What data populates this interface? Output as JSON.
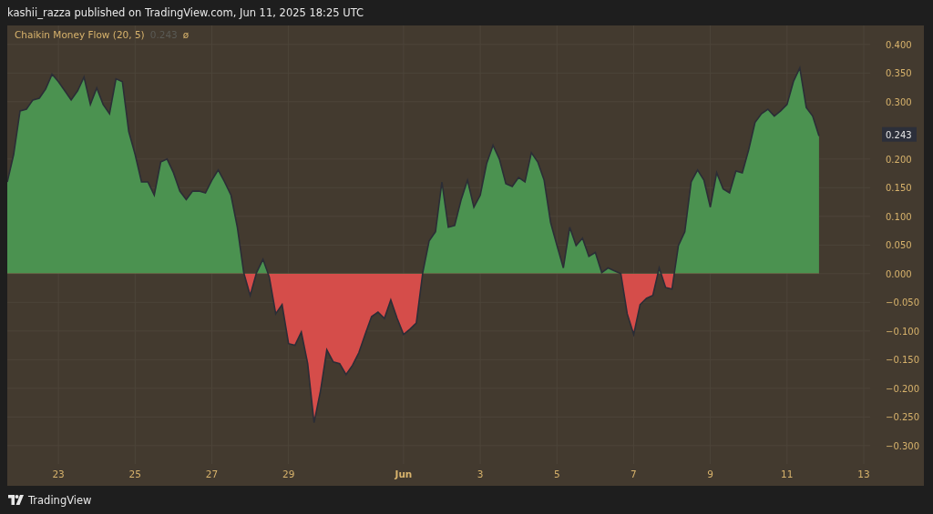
{
  "header": {
    "text": "kashii_razza published on TradingView.com, Jun 11, 2025 18:25 UTC"
  },
  "legend": {
    "value": "0.243",
    "symbol": "ø"
  },
  "chart": {
    "price_tag": "0.243",
    "chart_data": {
      "type": "area",
      "grid": true,
      "xlim": [
        "2025-05-21 16:00",
        "2025-06-13 04:00"
      ],
      "ylim": [
        -0.332,
        0.433
      ],
      "xticks": [
        {
          "value": "2025-05-23",
          "label": "23"
        },
        {
          "value": "2025-05-25",
          "label": "25"
        },
        {
          "value": "2025-05-27",
          "label": "27"
        },
        {
          "value": "2025-05-29",
          "label": "29"
        },
        {
          "value": "2025-06-01",
          "label": "Jun"
        },
        {
          "value": "2025-06-03",
          "label": "3"
        },
        {
          "value": "2025-06-05",
          "label": "5"
        },
        {
          "value": "2025-06-07",
          "label": "7"
        },
        {
          "value": "2025-06-09",
          "label": "9"
        },
        {
          "value": "2025-06-11",
          "label": "11"
        },
        {
          "value": "2025-06-13",
          "label": "13"
        }
      ],
      "yticks": [
        {
          "value": 0.4,
          "label": "0.400"
        },
        {
          "value": 0.35,
          "label": "0.350"
        },
        {
          "value": 0.3,
          "label": "0.300"
        },
        {
          "value": 0.2,
          "label": "0.200"
        },
        {
          "value": 0.15,
          "label": "0.150"
        },
        {
          "value": 0.1,
          "label": "0.100"
        },
        {
          "value": 0.05,
          "label": "0.050"
        },
        {
          "value": 0,
          "label": "0.000"
        },
        {
          "value": -0.05,
          "label": "−0.050"
        },
        {
          "value": -0.1,
          "label": "−0.100"
        },
        {
          "value": -0.15,
          "label": "−0.150"
        },
        {
          "value": -0.2,
          "label": "−0.200"
        },
        {
          "value": -0.25,
          "label": "−0.250"
        },
        {
          "value": -0.3,
          "label": "−0.300"
        }
      ],
      "x": [
        "2025-05-21 16:00",
        "2025-05-21 20:00",
        "2025-05-22 00:00",
        "2025-05-22 04:00",
        "2025-05-22 08:00",
        "2025-05-22 12:00",
        "2025-05-22 16:00",
        "2025-05-22 20:00",
        "2025-05-23 00:00",
        "2025-05-23 04:00",
        "2025-05-23 08:00",
        "2025-05-23 12:00",
        "2025-05-23 16:00",
        "2025-05-23 20:00",
        "2025-05-24 00:00",
        "2025-05-24 04:00",
        "2025-05-24 08:00",
        "2025-05-24 12:00",
        "2025-05-24 16:00",
        "2025-05-24 20:00",
        "2025-05-25 00:00",
        "2025-05-25 04:00",
        "2025-05-25 08:00",
        "2025-05-25 12:00",
        "2025-05-25 16:00",
        "2025-05-25 20:00",
        "2025-05-26 00:00",
        "2025-05-26 04:00",
        "2025-05-26 08:00",
        "2025-05-26 12:00",
        "2025-05-26 16:00",
        "2025-05-26 20:00",
        "2025-05-27 00:00",
        "2025-05-27 04:00",
        "2025-05-27 08:00",
        "2025-05-27 12:00",
        "2025-05-27 16:00",
        "2025-05-27 20:00",
        "2025-05-28 00:00",
        "2025-05-28 04:00",
        "2025-05-28 08:00",
        "2025-05-28 12:00",
        "2025-05-28 16:00",
        "2025-05-28 20:00",
        "2025-05-29 00:00",
        "2025-05-29 04:00",
        "2025-05-29 08:00",
        "2025-05-29 12:00",
        "2025-05-29 16:00",
        "2025-05-29 20:00",
        "2025-05-30 00:00",
        "2025-05-30 04:00",
        "2025-05-30 08:00",
        "2025-05-30 12:00",
        "2025-05-30 16:00",
        "2025-05-30 20:00",
        "2025-05-31 00:00",
        "2025-05-31 04:00",
        "2025-05-31 08:00",
        "2025-05-31 12:00",
        "2025-05-31 16:00",
        "2025-05-31 20:00",
        "2025-06-01 00:00",
        "2025-06-01 04:00",
        "2025-06-01 08:00",
        "2025-06-01 12:00",
        "2025-06-01 16:00",
        "2025-06-01 20:00",
        "2025-06-02 00:00",
        "2025-06-02 04:00",
        "2025-06-02 08:00",
        "2025-06-02 12:00",
        "2025-06-02 16:00",
        "2025-06-02 20:00",
        "2025-06-03 00:00",
        "2025-06-03 04:00",
        "2025-06-03 08:00",
        "2025-06-03 12:00",
        "2025-06-03 16:00",
        "2025-06-03 20:00",
        "2025-06-04 00:00",
        "2025-06-04 04:00",
        "2025-06-04 08:00",
        "2025-06-04 12:00",
        "2025-06-04 16:00",
        "2025-06-04 20:00",
        "2025-06-05 00:00",
        "2025-06-05 04:00",
        "2025-06-05 08:00",
        "2025-06-05 12:00",
        "2025-06-05 16:00",
        "2025-06-05 20:00",
        "2025-06-06 00:00",
        "2025-06-06 04:00",
        "2025-06-06 08:00",
        "2025-06-06 12:00",
        "2025-06-06 16:00",
        "2025-06-06 20:00",
        "2025-06-07 00:00",
        "2025-06-07 04:00",
        "2025-06-07 08:00",
        "2025-06-07 12:00",
        "2025-06-07 16:00",
        "2025-06-07 20:00",
        "2025-06-08 00:00",
        "2025-06-08 04:00",
        "2025-06-08 08:00",
        "2025-06-08 12:00",
        "2025-06-08 16:00",
        "2025-06-08 20:00",
        "2025-06-09 00:00",
        "2025-06-09 04:00",
        "2025-06-09 08:00",
        "2025-06-09 12:00",
        "2025-06-09 16:00",
        "2025-06-09 20:00",
        "2025-06-10 00:00",
        "2025-06-10 04:00",
        "2025-06-10 08:00",
        "2025-06-10 12:00",
        "2025-06-10 16:00",
        "2025-06-10 20:00",
        "2025-06-11 00:00",
        "2025-06-11 04:00",
        "2025-06-11 08:00",
        "2025-06-11 12:00",
        "2025-06-11 16:00",
        "2025-06-11 20:00"
      ],
      "series": [
        {
          "name": "Chaikin Money Flow (20, 5)",
          "color": "#4b9250",
          "values": [
            0.16,
            0.208,
            0.284,
            0.287,
            0.303,
            0.306,
            0.322,
            0.348,
            0.335,
            0.319,
            0.303,
            0.319,
            0.343,
            0.295,
            0.324,
            0.295,
            0.279,
            0.34,
            0.335,
            0.248,
            0.208,
            0.16,
            0.16,
            0.137,
            0.195,
            0.2,
            0.176,
            0.144,
            0.129,
            0.144,
            0.144,
            0.141,
            0.163,
            0.181,
            0.16,
            0.137,
            0.081,
            0.002,
            -0.038,
            0.002,
            0.025,
            -0.006,
            -0.07,
            -0.054,
            -0.122,
            -0.125,
            -0.102,
            -0.157,
            -0.26,
            -0.205,
            -0.133,
            -0.154,
            -0.157,
            -0.176,
            -0.16,
            -0.138,
            -0.106,
            -0.075,
            -0.067,
            -0.078,
            -0.046,
            -0.078,
            -0.106,
            -0.097,
            -0.086,
            0.002,
            0.057,
            0.073,
            0.16,
            0.081,
            0.084,
            0.129,
            0.163,
            0.116,
            0.137,
            0.192,
            0.224,
            0.2,
            0.157,
            0.152,
            0.168,
            0.16,
            0.211,
            0.195,
            0.163,
            0.089,
            0.049,
            0.01,
            0.081,
            0.049,
            0.062,
            0.03,
            0.037,
            0.002,
            0.01,
            0.005,
            0,
            -0.07,
            -0.106,
            -0.054,
            -0.043,
            -0.038,
            0.01,
            -0.024,
            -0.027,
            0.049,
            0.073,
            0.16,
            0.181,
            0.163,
            0.116,
            0.176,
            0.148,
            0.141,
            0.179,
            0.176,
            0.216,
            0.264,
            0.279,
            0.287,
            0.275,
            0.284,
            0.295,
            0.335,
            0.359,
            0.29,
            0.275,
            0.24
          ]
        }
      ]
    }
  },
  "footer": {
    "brand": "TradingView"
  }
}
